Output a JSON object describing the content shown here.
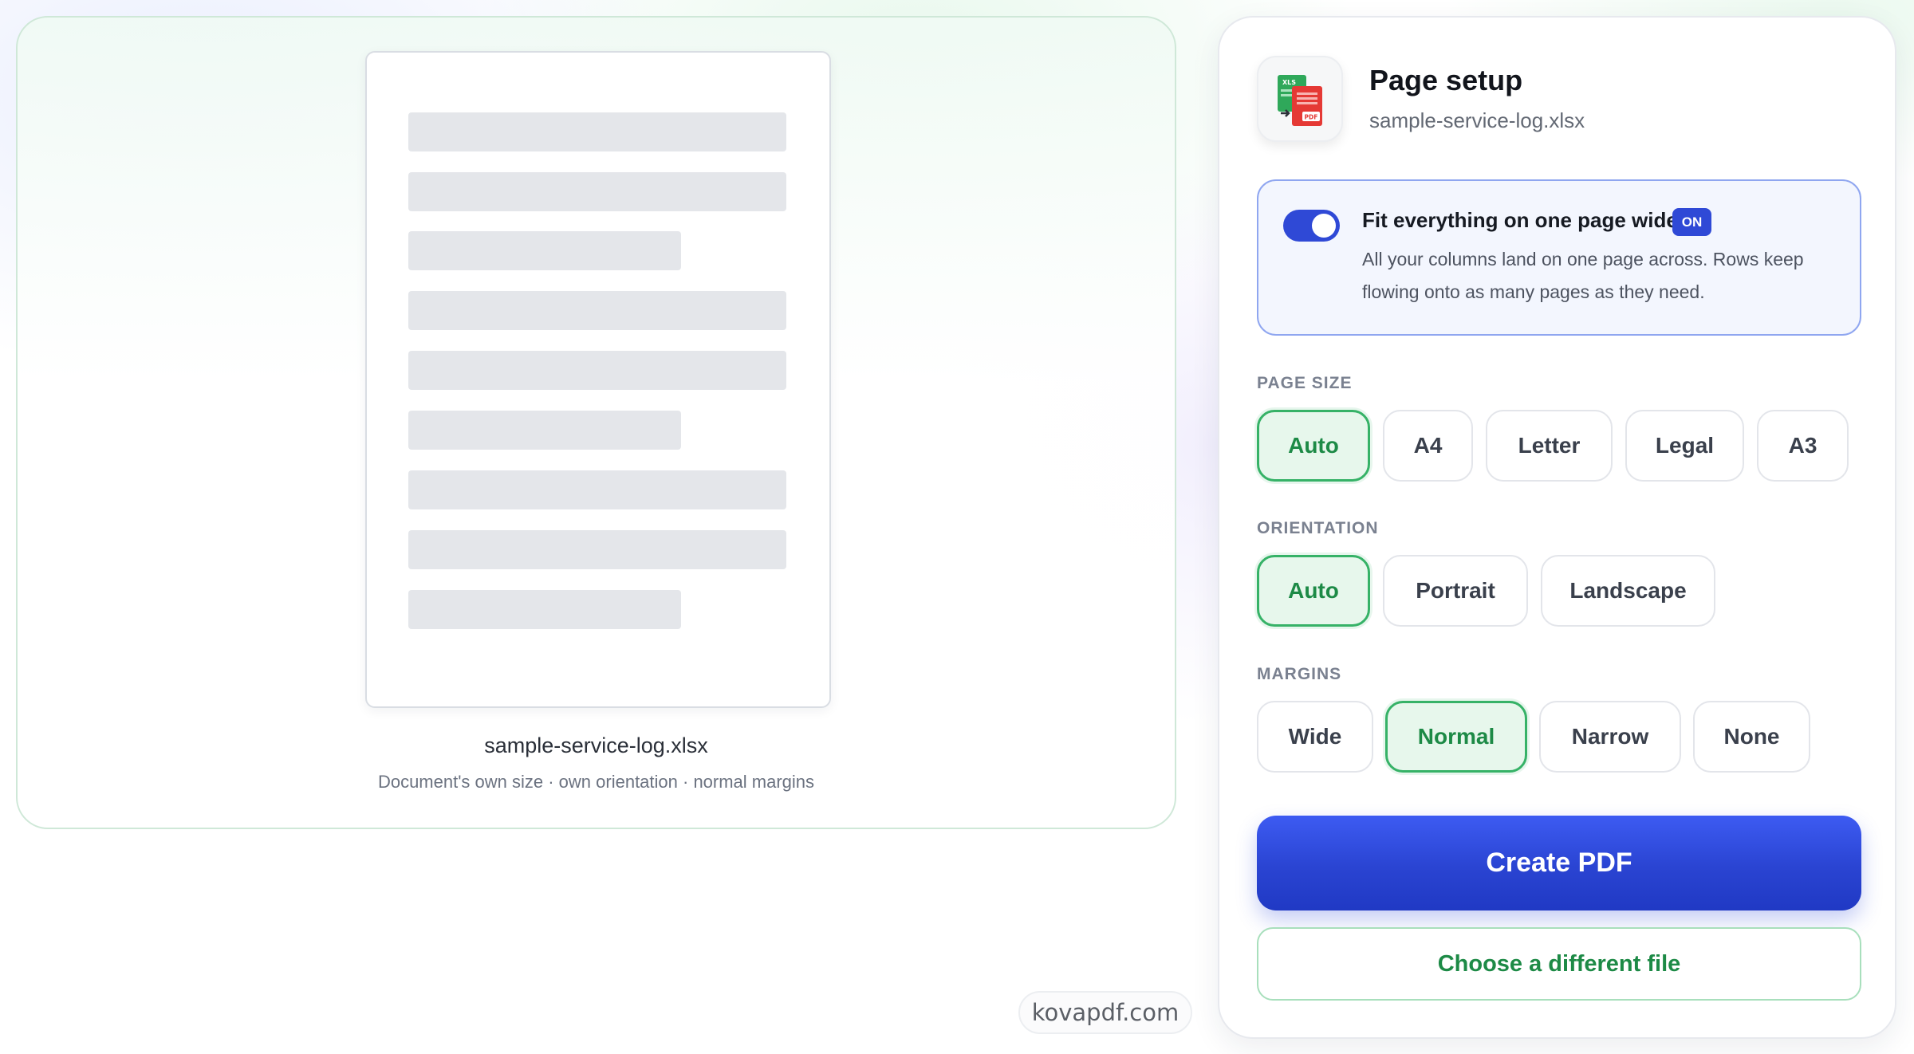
{
  "preview": {
    "filename": "sample-service-log.xlsx",
    "meta": "Document's own size · own orientation · normal margins"
  },
  "settings": {
    "title": "Page setup",
    "filename": "sample-service-log.xlsx",
    "app_icon": "xls-to-pdf-icon",
    "app_icon_text": {
      "xls": "XLS",
      "pdf": "PDF"
    },
    "fit": {
      "title": "Fit everything on one page wide",
      "badge": "ON",
      "enabled": true,
      "description": "All your columns land on one page across. Rows keep flowing onto as many pages as they need."
    },
    "page_size": {
      "label": "PAGE SIZE",
      "options": [
        "Auto",
        "A4",
        "Letter",
        "Legal",
        "A3"
      ],
      "selected": "Auto"
    },
    "orientation": {
      "label": "ORIENTATION",
      "options": [
        "Auto",
        "Portrait",
        "Landscape"
      ],
      "selected": "Auto"
    },
    "margins": {
      "label": "MARGINS",
      "options": [
        "Wide",
        "Normal",
        "Narrow",
        "None"
      ],
      "selected": "Normal"
    },
    "create_button": "Create PDF",
    "choose_button": "Choose a different file"
  },
  "watermark": "kovapdf.com",
  "colors": {
    "accent_blue": "#2f49d6",
    "accent_green": "#1d8a46",
    "selected_bg": "#e7f7ec"
  }
}
